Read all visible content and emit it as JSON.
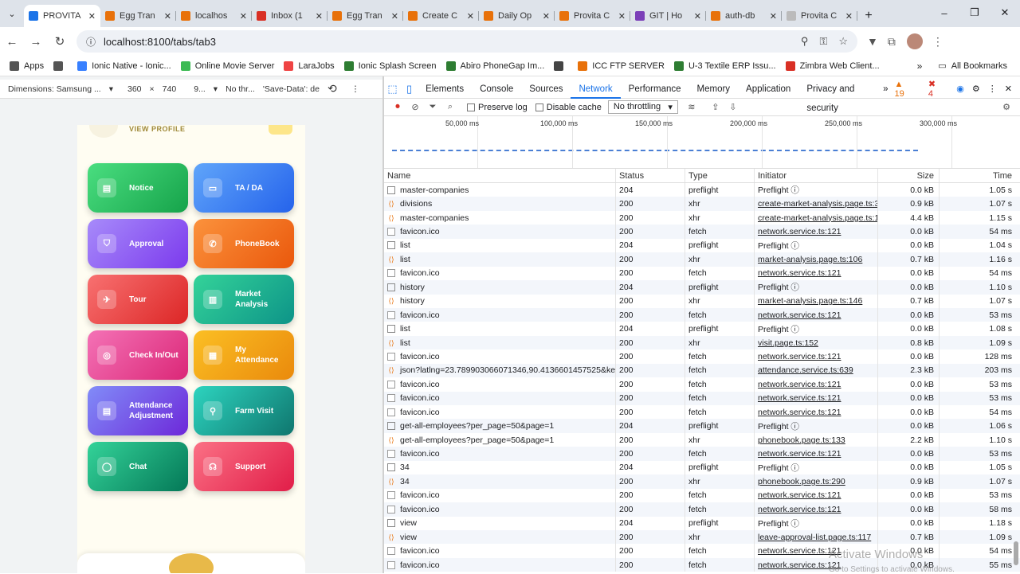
{
  "browser": {
    "tabs": [
      {
        "label": "PROVITA",
        "color": "#1a73e8",
        "active": true
      },
      {
        "label": "Egg Tran",
        "color": "#e8710a"
      },
      {
        "label": "localhos",
        "color": "#e8710a"
      },
      {
        "label": "Inbox (1",
        "color": "#d93025"
      },
      {
        "label": "Egg Tran",
        "color": "#e8710a"
      },
      {
        "label": "Create C",
        "color": "#e8710a"
      },
      {
        "label": "Daily Op",
        "color": "#e8710a"
      },
      {
        "label": "Provita C",
        "color": "#e8710a"
      },
      {
        "label": "GIT | Ho",
        "color": "#7b3fb8"
      },
      {
        "label": "auth-db",
        "color": "#e8710a"
      },
      {
        "label": "Provita C",
        "color": "#bbb"
      }
    ],
    "url": "localhost:8100/tabs/tab3",
    "bookmarks": [
      {
        "label": "Apps",
        "color": "#555"
      },
      {
        "label": "",
        "color": "#555"
      },
      {
        "label": "Ionic Native - Ionic...",
        "color": "#3880ff"
      },
      {
        "label": "Online Movie Server",
        "color": "#3cba54"
      },
      {
        "label": "LaraJobs",
        "color": "#ef4444"
      },
      {
        "label": "Ionic Splash Screen",
        "color": "#2e7d32"
      },
      {
        "label": "Abiro PhoneGap Im...",
        "color": "#2e7d32"
      },
      {
        "label": "",
        "color": "#444"
      },
      {
        "label": "ICC FTP SERVER",
        "color": "#e8710a"
      },
      {
        "label": "U-3 Textile ERP Issu...",
        "color": "#2e7d32"
      },
      {
        "label": "Zimbra Web Client...",
        "color": "#d93025"
      }
    ],
    "all_bookmarks": "All Bookmarks"
  },
  "device_bar": {
    "dimensions": "Dimensions: Samsung ...",
    "width": "360",
    "height": "740",
    "zoom": "9...",
    "throttle": "No thr...",
    "save_data": "'Save-Data': de"
  },
  "app": {
    "view_profile": "VIEW PROFILE",
    "tiles": [
      {
        "label": "Notice",
        "icon": "document-icon",
        "glyph": "▤",
        "from": "#4ade80",
        "to": "#16a34a"
      },
      {
        "label": "TA / DA",
        "icon": "wallet-icon",
        "glyph": "▭",
        "from": "#60a5fa",
        "to": "#2563eb"
      },
      {
        "label": "Approval",
        "icon": "shield-check-icon",
        "glyph": "⛉",
        "from": "#a78bfa",
        "to": "#7c3aed"
      },
      {
        "label": "PhoneBook",
        "icon": "phone-icon",
        "glyph": "✆",
        "from": "#fb923c",
        "to": "#ea580c"
      },
      {
        "label": "Tour",
        "icon": "airplane-icon",
        "glyph": "✈",
        "from": "#f87171",
        "to": "#dc2626"
      },
      {
        "label": "Market Analysis",
        "icon": "bar-chart-icon",
        "glyph": "▥",
        "from": "#34d399",
        "to": "#0d9488"
      },
      {
        "label": "Check In/Out",
        "icon": "fingerprint-icon",
        "glyph": "◎",
        "from": "#f472b6",
        "to": "#db2777"
      },
      {
        "label": "My Attendance",
        "icon": "calendar-icon",
        "glyph": "▦",
        "from": "#fbbf24",
        "to": "#ea8a0c"
      },
      {
        "label": "Attendance Adjustment",
        "icon": "document-edit-icon",
        "glyph": "▤",
        "from": "#818cf8",
        "to": "#6d28d9"
      },
      {
        "label": "Farm Visit",
        "icon": "location-pin-icon",
        "glyph": "⚲",
        "from": "#2dd4bf",
        "to": "#0f766e"
      },
      {
        "label": "Chat",
        "icon": "chat-bubble-icon",
        "glyph": "◯",
        "from": "#34d399",
        "to": "#047857"
      },
      {
        "label": "Support",
        "icon": "headset-icon",
        "glyph": "☊",
        "from": "#fb7185",
        "to": "#e11d48"
      }
    ]
  },
  "devtools": {
    "tabs": [
      "Elements",
      "Console",
      "Sources",
      "Network",
      "Performance",
      "Memory",
      "Application",
      "Privacy and security"
    ],
    "active_tab": "Network",
    "warnings": "19",
    "errors": "4",
    "preserve_log": "Preserve log",
    "disable_cache": "Disable cache",
    "throttling": "No throttling",
    "timeline_ticks": [
      "50,000 ms",
      "100,000 ms",
      "150,000 ms",
      "200,000 ms",
      "250,000 ms",
      "300,000 ms"
    ],
    "columns": [
      "Name",
      "Status",
      "Type",
      "Initiator",
      "Size",
      "Time"
    ],
    "rows": [
      {
        "name": "master-companies",
        "kind": "doc",
        "status": "204",
        "type": "preflight",
        "initiator": "Preflight ⓘ",
        "link": false,
        "size": "0.0 kB",
        "time": "1.05 s"
      },
      {
        "name": "divisions",
        "kind": "xhr",
        "status": "200",
        "type": "xhr",
        "initiator": "create-market-analysis.page.ts:3",
        "link": true,
        "size": "0.9 kB",
        "time": "1.07 s"
      },
      {
        "name": "master-companies",
        "kind": "xhr",
        "status": "200",
        "type": "xhr",
        "initiator": "create-market-analysis.page.ts:1",
        "link": true,
        "size": "4.4 kB",
        "time": "1.15 s"
      },
      {
        "name": "favicon.ico",
        "kind": "ico",
        "status": "200",
        "type": "fetch",
        "initiator": "network.service.ts:121",
        "link": true,
        "size": "0.0 kB",
        "time": "54 ms"
      },
      {
        "name": "list",
        "kind": "doc",
        "status": "204",
        "type": "preflight",
        "initiator": "Preflight ⓘ",
        "link": false,
        "size": "0.0 kB",
        "time": "1.04 s"
      },
      {
        "name": "list",
        "kind": "xhr",
        "status": "200",
        "type": "xhr",
        "initiator": "market-analysis.page.ts:106",
        "link": true,
        "size": "0.7 kB",
        "time": "1.16 s"
      },
      {
        "name": "favicon.ico",
        "kind": "ico",
        "status": "200",
        "type": "fetch",
        "initiator": "network.service.ts:121",
        "link": true,
        "size": "0.0 kB",
        "time": "54 ms"
      },
      {
        "name": "history",
        "kind": "doc",
        "status": "204",
        "type": "preflight",
        "initiator": "Preflight ⓘ",
        "link": false,
        "size": "0.0 kB",
        "time": "1.10 s"
      },
      {
        "name": "history",
        "kind": "xhr",
        "status": "200",
        "type": "xhr",
        "initiator": "market-analysis.page.ts:146",
        "link": true,
        "size": "0.7 kB",
        "time": "1.07 s"
      },
      {
        "name": "favicon.ico",
        "kind": "ico",
        "status": "200",
        "type": "fetch",
        "initiator": "network.service.ts:121",
        "link": true,
        "size": "0.0 kB",
        "time": "53 ms"
      },
      {
        "name": "list",
        "kind": "doc",
        "status": "204",
        "type": "preflight",
        "initiator": "Preflight ⓘ",
        "link": false,
        "size": "0.0 kB",
        "time": "1.08 s"
      },
      {
        "name": "list",
        "kind": "xhr",
        "status": "200",
        "type": "xhr",
        "initiator": "visit.page.ts:152",
        "link": true,
        "size": "0.8 kB",
        "time": "1.09 s"
      },
      {
        "name": "favicon.ico",
        "kind": "ico",
        "status": "200",
        "type": "fetch",
        "initiator": "network.service.ts:121",
        "link": true,
        "size": "0.0 kB",
        "time": "128 ms"
      },
      {
        "name": "json?latlng=23.789903066071346,90.4136601457525&key...",
        "kind": "xhr",
        "status": "200",
        "type": "fetch",
        "initiator": "attendance.service.ts:639",
        "link": true,
        "size": "2.3 kB",
        "time": "203 ms"
      },
      {
        "name": "favicon.ico",
        "kind": "ico",
        "status": "200",
        "type": "fetch",
        "initiator": "network.service.ts:121",
        "link": true,
        "size": "0.0 kB",
        "time": "53 ms"
      },
      {
        "name": "favicon.ico",
        "kind": "ico",
        "status": "200",
        "type": "fetch",
        "initiator": "network.service.ts:121",
        "link": true,
        "size": "0.0 kB",
        "time": "53 ms"
      },
      {
        "name": "favicon.ico",
        "kind": "ico",
        "status": "200",
        "type": "fetch",
        "initiator": "network.service.ts:121",
        "link": true,
        "size": "0.0 kB",
        "time": "54 ms"
      },
      {
        "name": "get-all-employees?per_page=50&page=1",
        "kind": "doc",
        "status": "204",
        "type": "preflight",
        "initiator": "Preflight ⓘ",
        "link": false,
        "size": "0.0 kB",
        "time": "1.06 s"
      },
      {
        "name": "get-all-employees?per_page=50&page=1",
        "kind": "xhr",
        "status": "200",
        "type": "xhr",
        "initiator": "phonebook.page.ts:133",
        "link": true,
        "size": "2.2 kB",
        "time": "1.10 s"
      },
      {
        "name": "favicon.ico",
        "kind": "ico",
        "status": "200",
        "type": "fetch",
        "initiator": "network.service.ts:121",
        "link": true,
        "size": "0.0 kB",
        "time": "53 ms"
      },
      {
        "name": "34",
        "kind": "doc",
        "status": "204",
        "type": "preflight",
        "initiator": "Preflight ⓘ",
        "link": false,
        "size": "0.0 kB",
        "time": "1.05 s"
      },
      {
        "name": "34",
        "kind": "xhr",
        "status": "200",
        "type": "xhr",
        "initiator": "phonebook.page.ts:290",
        "link": true,
        "size": "0.9 kB",
        "time": "1.07 s"
      },
      {
        "name": "favicon.ico",
        "kind": "ico",
        "status": "200",
        "type": "fetch",
        "initiator": "network.service.ts:121",
        "link": true,
        "size": "0.0 kB",
        "time": "53 ms"
      },
      {
        "name": "favicon.ico",
        "kind": "ico",
        "status": "200",
        "type": "fetch",
        "initiator": "network.service.ts:121",
        "link": true,
        "size": "0.0 kB",
        "time": "58 ms"
      },
      {
        "name": "view",
        "kind": "doc",
        "status": "204",
        "type": "preflight",
        "initiator": "Preflight ⓘ",
        "link": false,
        "size": "0.0 kB",
        "time": "1.18 s"
      },
      {
        "name": "view",
        "kind": "xhr",
        "status": "200",
        "type": "xhr",
        "initiator": "leave-approval-list.page.ts:117",
        "link": true,
        "size": "0.7 kB",
        "time": "1.09 s"
      },
      {
        "name": "favicon.ico",
        "kind": "ico",
        "status": "200",
        "type": "fetch",
        "initiator": "network.service.ts:121",
        "link": true,
        "size": "0.0 kB",
        "time": "54 ms"
      },
      {
        "name": "favicon.ico",
        "kind": "ico",
        "status": "200",
        "type": "fetch",
        "initiator": "network.service.ts:121",
        "link": true,
        "size": "0.0 kB",
        "time": "55 ms"
      }
    ]
  },
  "watermark": {
    "line1": "Activate Windows",
    "line2": "Go to Settings to activate Windows."
  }
}
